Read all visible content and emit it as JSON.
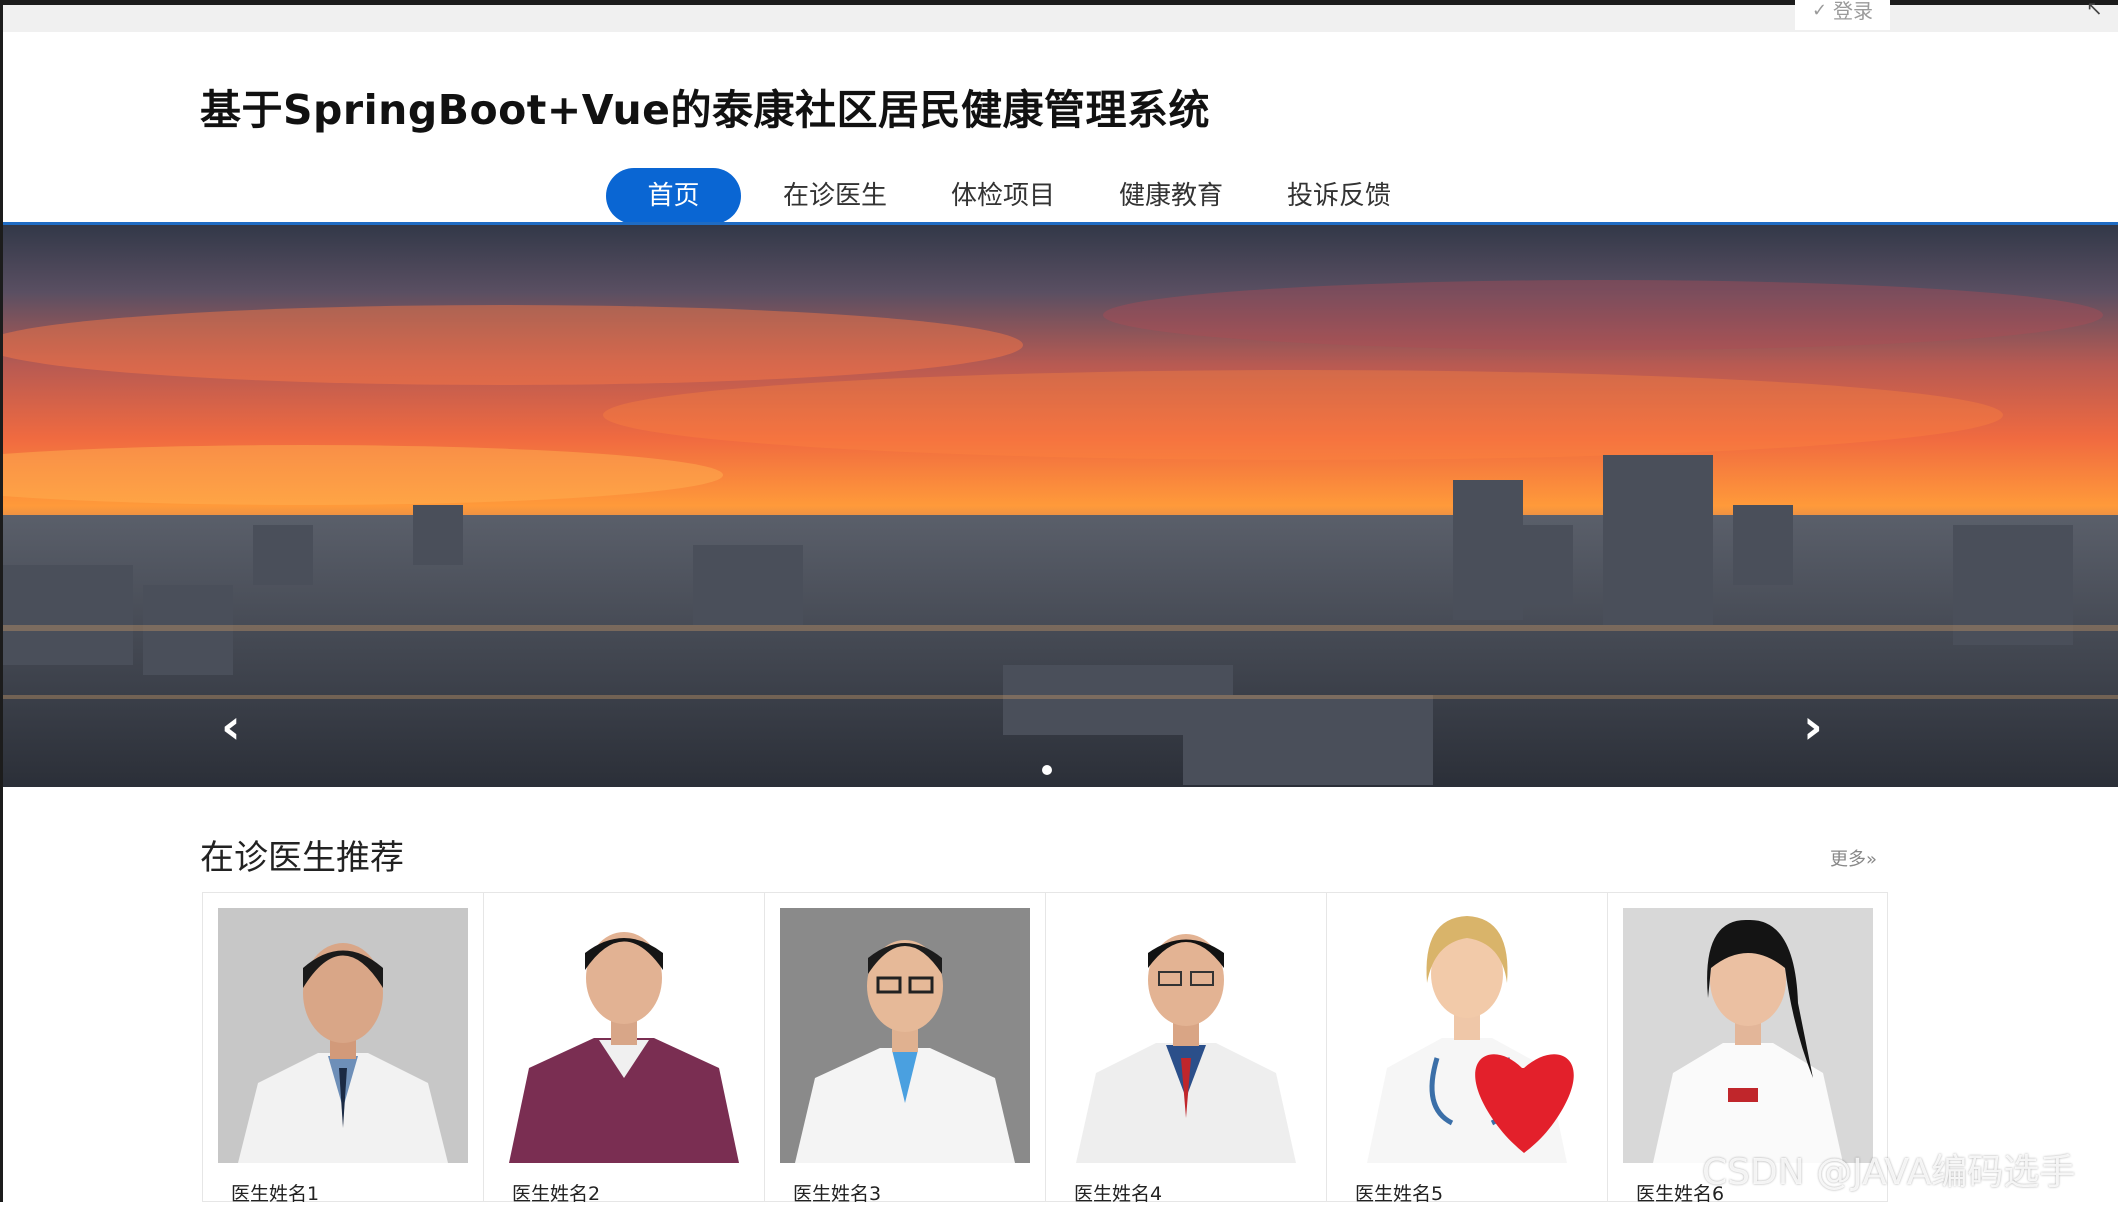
{
  "top": {
    "login_label": "登录",
    "login_icon": "check-circle-icon",
    "cursor_icon": "cursor-icon"
  },
  "header": {
    "title": "基于SpringBoot+Vue的泰康社区居民健康管理系统"
  },
  "nav": {
    "items": [
      {
        "label": "首页",
        "active": true
      },
      {
        "label": "在诊医生",
        "active": false
      },
      {
        "label": "体检项目",
        "active": false
      },
      {
        "label": "健康教育",
        "active": false
      },
      {
        "label": "投诉反馈",
        "active": false
      }
    ],
    "accent": "#0a66d3"
  },
  "banner": {
    "prev_icon": "chevron-left-icon",
    "next_icon": "chevron-right-icon",
    "slides": 1,
    "active_slide": 1
  },
  "doctors": {
    "title": "在诊医生推荐",
    "more_label": "更多»",
    "items": [
      {
        "name": "医生姓名1"
      },
      {
        "name": "医生姓名2"
      },
      {
        "name": "医生姓名3"
      },
      {
        "name": "医生姓名4"
      },
      {
        "name": "医生姓名5"
      },
      {
        "name": "医生姓名6"
      }
    ]
  },
  "watermark": "CSDN @JAVA编码选手"
}
